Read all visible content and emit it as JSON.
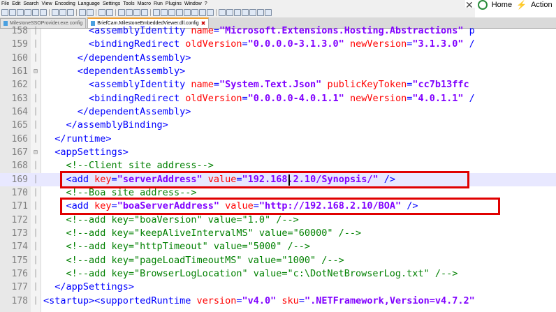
{
  "menu": [
    "File",
    "Edit",
    "Search",
    "View",
    "Encoding",
    "Language",
    "Settings",
    "Tools",
    "Macro",
    "Run",
    "Plugins",
    "Window",
    "?"
  ],
  "overlay": {
    "home_label": "Home",
    "action_label": "Action"
  },
  "tabs": [
    {
      "label": "MilestoneSSOProvider.exe.config",
      "active": false
    },
    {
      "label": "BriefCam.MilestoneEmbeddedViewer.dll.config",
      "active": true
    }
  ],
  "lines": [
    {
      "n": "158",
      "tokens": [
        [
          "i",
          "        "
        ],
        [
          "t",
          "<assemblyIdentity "
        ],
        [
          "a",
          "name"
        ],
        [
          "t",
          "="
        ],
        [
          "v",
          "\"Microsoft.Extensions.Hosting.Abstractions\""
        ],
        [
          "t",
          " p"
        ]
      ]
    },
    {
      "n": "159",
      "tokens": [
        [
          "i",
          "        "
        ],
        [
          "t",
          "<bindingRedirect "
        ],
        [
          "a",
          "oldVersion"
        ],
        [
          "t",
          "="
        ],
        [
          "v",
          "\"0.0.0.0-3.1.3.0\""
        ],
        [
          "t",
          " "
        ],
        [
          "a",
          "newVersion"
        ],
        [
          "t",
          "="
        ],
        [
          "v",
          "\"3.1.3.0\""
        ],
        [
          "t",
          " /"
        ]
      ]
    },
    {
      "n": "160",
      "tokens": [
        [
          "i",
          "      "
        ],
        [
          "t",
          "</dependentAssembly>"
        ]
      ]
    },
    {
      "n": "161",
      "tokens": [
        [
          "i",
          "      "
        ],
        [
          "t",
          "<dependentAssembly>"
        ]
      ]
    },
    {
      "n": "162",
      "tokens": [
        [
          "i",
          "        "
        ],
        [
          "t",
          "<assemblyIdentity "
        ],
        [
          "a",
          "name"
        ],
        [
          "t",
          "="
        ],
        [
          "v",
          "\"System.Text.Json\""
        ],
        [
          "t",
          " "
        ],
        [
          "a",
          "publicKeyToken"
        ],
        [
          "t",
          "="
        ],
        [
          "v",
          "\"cc7b13ffc"
        ]
      ]
    },
    {
      "n": "163",
      "tokens": [
        [
          "i",
          "        "
        ],
        [
          "t",
          "<bindingRedirect "
        ],
        [
          "a",
          "oldVersion"
        ],
        [
          "t",
          "="
        ],
        [
          "v",
          "\"0.0.0.0-4.0.1.1\""
        ],
        [
          "t",
          " "
        ],
        [
          "a",
          "newVersion"
        ],
        [
          "t",
          "="
        ],
        [
          "v",
          "\"4.0.1.1\""
        ],
        [
          "t",
          " /"
        ]
      ]
    },
    {
      "n": "164",
      "tokens": [
        [
          "i",
          "      "
        ],
        [
          "t",
          "</dependentAssembly>"
        ]
      ]
    },
    {
      "n": "165",
      "tokens": [
        [
          "i",
          "    "
        ],
        [
          "t",
          "</assemblyBinding>"
        ]
      ]
    },
    {
      "n": "166",
      "tokens": [
        [
          "i",
          "  "
        ],
        [
          "t",
          "</runtime>"
        ]
      ]
    },
    {
      "n": "167",
      "tokens": [
        [
          "i",
          "  "
        ],
        [
          "t",
          "<appSettings>"
        ]
      ]
    },
    {
      "n": "168",
      "tokens": [
        [
          "i",
          "    "
        ],
        [
          "c",
          "<!--Client site address-->"
        ]
      ]
    },
    {
      "n": "169",
      "tokens": [
        [
          "i",
          "    "
        ],
        [
          "t",
          "<add "
        ],
        [
          "a",
          "key"
        ],
        [
          "t",
          "="
        ],
        [
          "v",
          "\"serverAddress\""
        ],
        [
          "t",
          " "
        ],
        [
          "a",
          "value"
        ],
        [
          "t",
          "="
        ],
        [
          "v",
          "\"192.168.2.10/Synopsis/\""
        ],
        [
          "t",
          " />"
        ]
      ]
    },
    {
      "n": "170",
      "tokens": [
        [
          "i",
          "    "
        ],
        [
          "c",
          "<!--Boa site address-->"
        ]
      ]
    },
    {
      "n": "171",
      "tokens": [
        [
          "i",
          "    "
        ],
        [
          "t",
          "<add "
        ],
        [
          "a",
          "key"
        ],
        [
          "t",
          "="
        ],
        [
          "v",
          "\"boaServerAddress\""
        ],
        [
          "t",
          " "
        ],
        [
          "a",
          "value"
        ],
        [
          "t",
          "="
        ],
        [
          "v",
          "\"http://192.168.2.10/BOA\""
        ],
        [
          "t",
          " />"
        ]
      ]
    },
    {
      "n": "172",
      "tokens": [
        [
          "i",
          "    "
        ],
        [
          "c",
          "<!--add key=\"boaVersion\" value=\"1.0\" /-->"
        ]
      ]
    },
    {
      "n": "173",
      "tokens": [
        [
          "i",
          "    "
        ],
        [
          "c",
          "<!--add key=\"keepAliveIntervalMS\" value=\"60000\" /-->"
        ]
      ]
    },
    {
      "n": "174",
      "tokens": [
        [
          "i",
          "    "
        ],
        [
          "c",
          "<!--add key=\"httpTimeout\" value=\"5000\" /-->"
        ]
      ]
    },
    {
      "n": "175",
      "tokens": [
        [
          "i",
          "    "
        ],
        [
          "c",
          "<!--add key=\"pageLoadTimeoutMS\" value=\"1000\" /-->"
        ]
      ]
    },
    {
      "n": "176",
      "tokens": [
        [
          "i",
          "    "
        ],
        [
          "c",
          "<!--add key=\"BrowserLogLocation\" value=\"c:\\DotNetBrowserLog.txt\" /-->"
        ]
      ]
    },
    {
      "n": "177",
      "tokens": [
        [
          "i",
          "  "
        ],
        [
          "t",
          "</appSettings>"
        ]
      ]
    },
    {
      "n": "178",
      "tokens": [
        [
          "t",
          "<startup><supportedRuntime "
        ],
        [
          "a",
          "version"
        ],
        [
          "t",
          "="
        ],
        [
          "v",
          "\"v4.0\""
        ],
        [
          "t",
          " "
        ],
        [
          "a",
          "sku"
        ],
        [
          "t",
          "="
        ],
        [
          "v",
          "\".NETFramework,Version=v4.7.2\""
        ]
      ]
    }
  ],
  "colors": {
    "tag": "#0000ff",
    "attr": "#ff0000",
    "value": "#8000ff",
    "comment": "#008000",
    "highlight_box": "#e00000"
  }
}
